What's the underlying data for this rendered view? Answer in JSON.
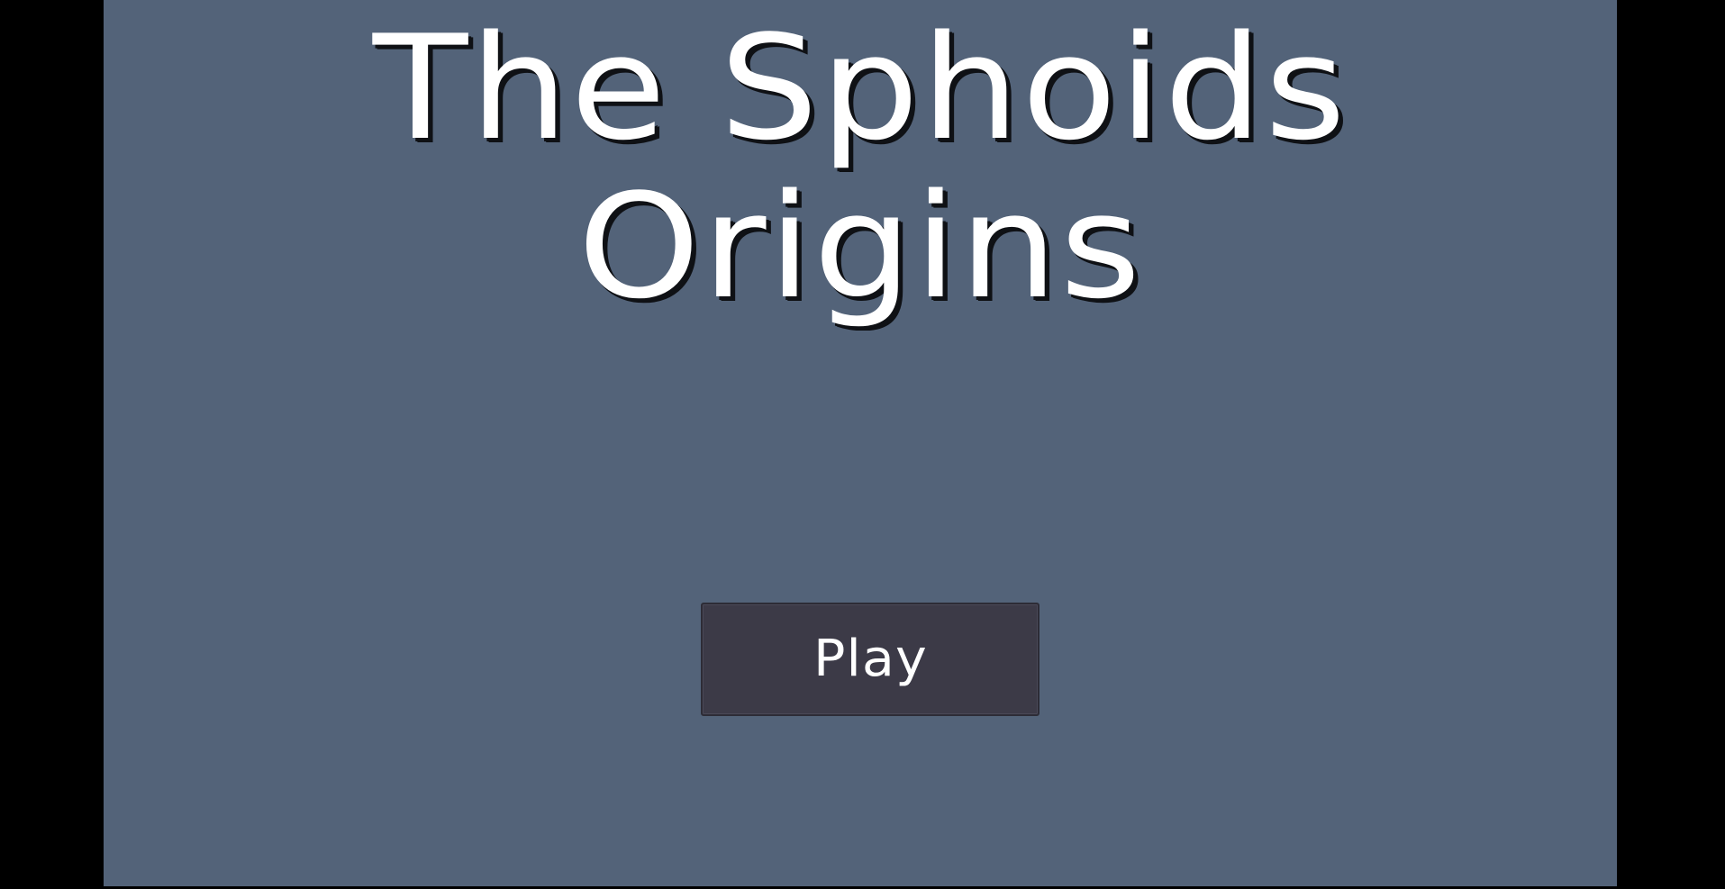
{
  "game": {
    "title_line_1": "The Sphoids",
    "title_line_2": "Origins"
  },
  "menu": {
    "play_label": "Play"
  },
  "colors": {
    "background": "#536379",
    "letterbox": "#000000",
    "button_fill": "#3c3a47",
    "text": "#ffffff"
  }
}
